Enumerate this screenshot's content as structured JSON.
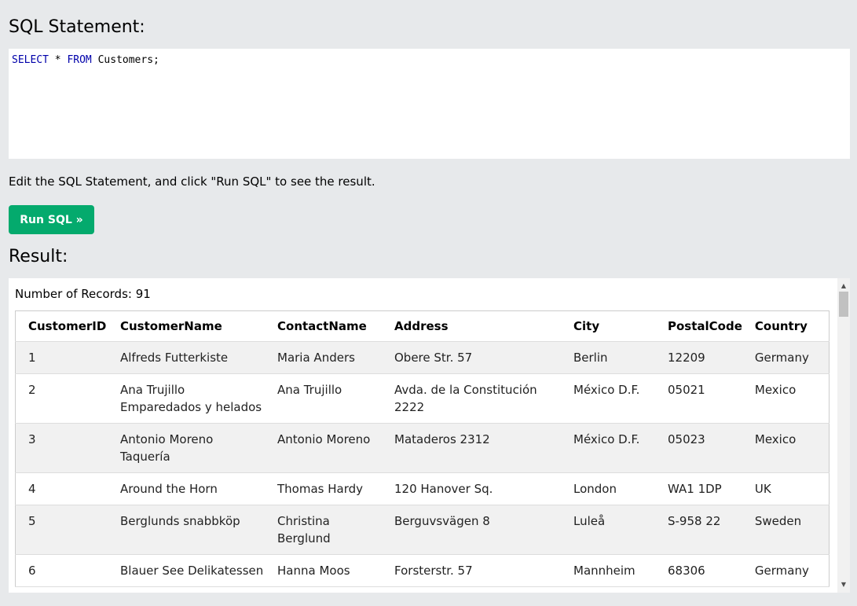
{
  "sql_section": {
    "title": "SQL Statement:",
    "query_keyword1": "SELECT",
    "query_middle": " * ",
    "query_keyword2": "FROM",
    "query_rest": " Customers;",
    "instructions": "Edit the SQL Statement, and click \"Run SQL\" to see the result.",
    "run_button_label": "Run SQL »"
  },
  "result_section": {
    "title": "Result:",
    "records_text": "Number of Records: 91",
    "columns": [
      "CustomerID",
      "CustomerName",
      "ContactName",
      "Address",
      "City",
      "PostalCode",
      "Country"
    ],
    "rows": [
      [
        "1",
        "Alfreds Futterkiste",
        "Maria Anders",
        "Obere Str. 57",
        "Berlin",
        "12209",
        "Germany"
      ],
      [
        "2",
        "Ana Trujillo Emparedados y helados",
        "Ana Trujillo",
        "Avda. de la Constitución 2222",
        "México D.F.",
        "05021",
        "Mexico"
      ],
      [
        "3",
        "Antonio Moreno Taquería",
        "Antonio Moreno",
        "Mataderos 2312",
        "México D.F.",
        "05023",
        "Mexico"
      ],
      [
        "4",
        "Around the Horn",
        "Thomas Hardy",
        "120 Hanover Sq.",
        "London",
        "WA1 1DP",
        "UK"
      ],
      [
        "5",
        "Berglunds snabbköp",
        "Christina Berglund",
        "Berguvsvägen 8",
        "Luleå",
        "S-958 22",
        "Sweden"
      ],
      [
        "6",
        "Blauer See Delikatessen",
        "Hanna Moos",
        "Forsterstr. 57",
        "Mannheim",
        "68306",
        "Germany"
      ]
    ]
  },
  "colors": {
    "background": "#e7e9eb",
    "button": "#04aa6d",
    "sql_keyword": "#0000aa"
  },
  "icons": {
    "scroll_up": "triangle-up-icon",
    "scroll_down": "triangle-down-icon"
  }
}
